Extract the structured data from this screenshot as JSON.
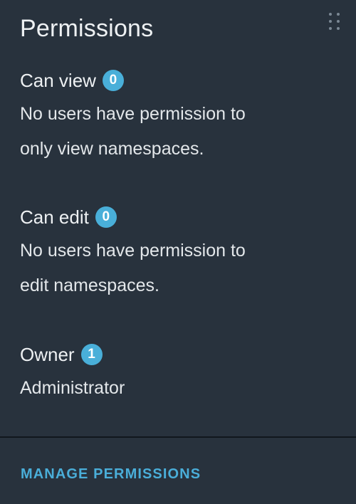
{
  "panel": {
    "title": "Permissions",
    "drag_icon": "drag-handle-icon"
  },
  "sections": [
    {
      "heading": "Can view",
      "count": "0",
      "description_line1": "No users have permission to",
      "description_line2": "only view namespaces."
    },
    {
      "heading": "Can edit",
      "count": "0",
      "description_line1": "No users have permission to",
      "description_line2": "edit namespaces."
    },
    {
      "heading": "Owner",
      "count": "1",
      "description_line1": "Administrator"
    }
  ],
  "footer": {
    "action_label": "MANAGE PERMISSIONS"
  },
  "colors": {
    "background": "#28323d",
    "accent": "#49afd9",
    "text": "#e8ecef"
  }
}
